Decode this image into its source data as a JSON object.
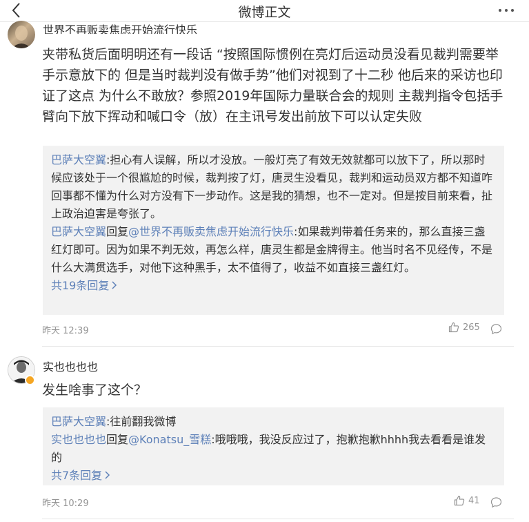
{
  "header": {
    "title": "微博正文",
    "back_icon": "chevron-left-icon",
    "more_icon": "more-dots-icon"
  },
  "comments": [
    {
      "username": "世界不再贩卖焦虑开始流行快乐",
      "text": "夹带私货后面明明还有一段话 “按照国际惯例在亮灯后运动员没看见裁判需要举手示意放下的 但是当时裁判没有做手势”他们对视到了十二秒 他后来的采访也印证了这点 为什么不敢放？参照2019年国际力量联合会的规则 主裁判指令包括手臂向下放下挥动和喊口令（放）在主讯号发出前放下可以认定失败",
      "replies": [
        {
          "author": "巴萨大空翼",
          "separator": ":",
          "content": "担心有人误解，所以才没放。一般灯亮了有效无效就都可以放下了，所以那时候应该处于一个很尴尬的时候，裁判按了灯，唐灵生没看见，裁判和运动员双方都不知道咋回事都不懂为什么对方没有下一步动作。这是我的猜想，也不一定对。但是按目前来看，扯上政治迫害是夸张了。"
        },
        {
          "author": "巴萨大空翼",
          "reply_word": "回复",
          "target": "@世界不再贩卖焦虑开始流行快乐",
          "separator": ":",
          "content": "如果裁判带着任务来的，那么直接三盏红灯即可。因为如果不判无效，再怎么样，唐灵生都是金牌得主。他当时名不见经传，不是什么大满贯选手，对他下这种黑手，太不值得了，收益不如直接三盏红灯。"
        }
      ],
      "more_replies": "共19条回复",
      "time": "昨天 12:39",
      "likes": "265"
    },
    {
      "username": "实也也也也",
      "text": "发生啥事了这个？",
      "replies": [
        {
          "author": "巴萨大空翼",
          "separator": ":",
          "content": "往前翻我微博"
        },
        {
          "author": "实也也也也",
          "reply_word": "回复",
          "target": "@Konatsu_雪糕",
          "separator": ":",
          "content": "哦哦哦，我没反应过了，抱歉抱歉hhhh我去看看是谁发的"
        }
      ],
      "more_replies": "共7条回复",
      "time": "昨天 10:29",
      "likes": "41"
    }
  ],
  "colors": {
    "link": "#5d80b8",
    "reply_bg": "#f2f2f2",
    "meta": "#939393",
    "text": "#333333",
    "verified_badge": "#f5a623"
  }
}
